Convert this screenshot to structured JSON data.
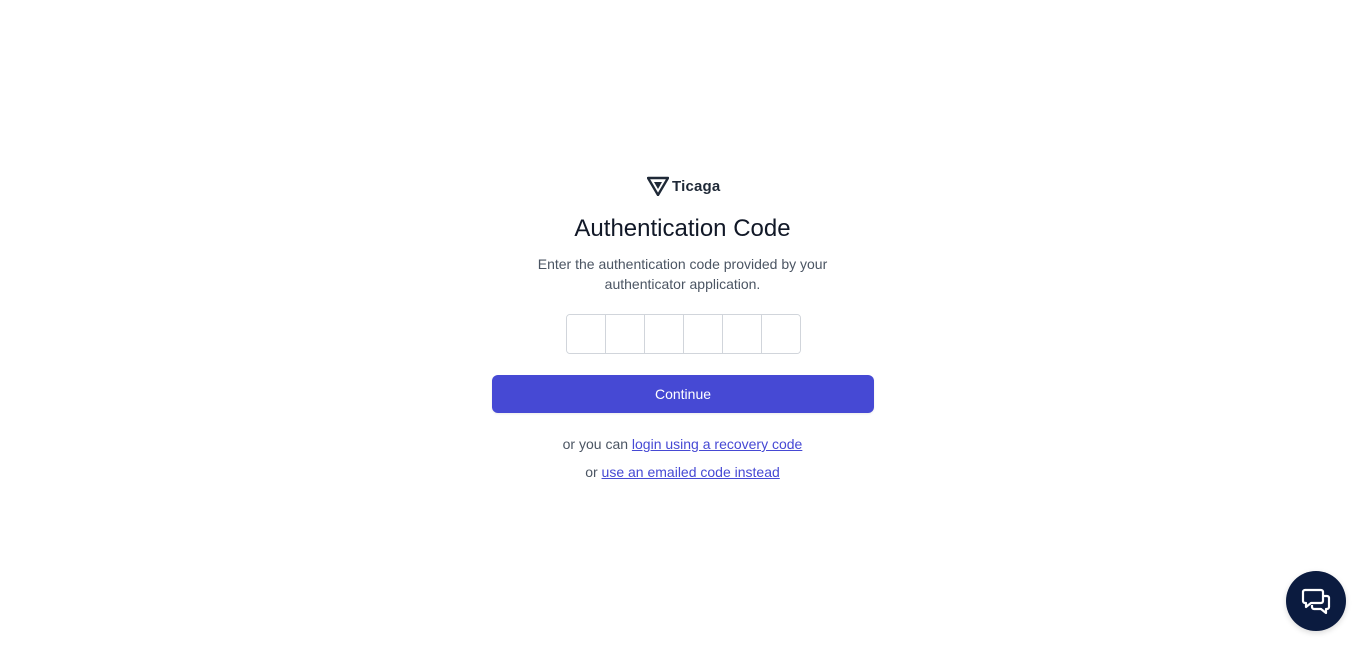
{
  "brand": {
    "name": "Ticaga",
    "logo_icon": "ticaga-logo-icon"
  },
  "auth": {
    "title": "Authentication Code",
    "subtitle": "Enter the authentication code provided by your authenticator application.",
    "code_digits": [
      "",
      "",
      "",
      "",
      "",
      ""
    ],
    "continue_label": "Continue",
    "recovery_prefix": "or you can ",
    "recovery_link": "login using a recovery code",
    "email_prefix": "or ",
    "email_link": "use an emailed code instead"
  },
  "chat_widget": {
    "icon": "chat-bubbles-icon"
  },
  "colors": {
    "accent": "#4649d4",
    "chat_bg": "#0b1b3f",
    "text": "#111827",
    "muted": "#4b5563"
  }
}
